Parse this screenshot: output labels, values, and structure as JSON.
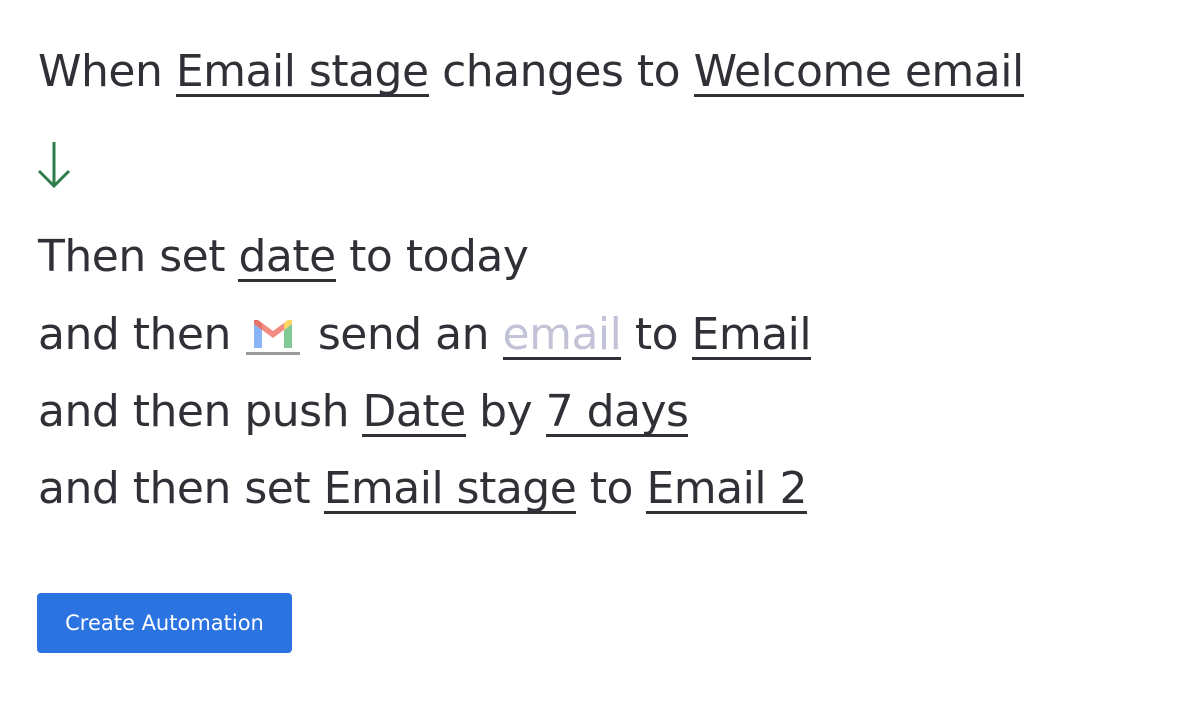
{
  "trigger": {
    "prefix": "When",
    "field": "Email stage",
    "verb": "changes to",
    "value": "Welcome email"
  },
  "arrow": {
    "icon": "arrow-down-icon",
    "color": "#2e7d4a"
  },
  "actions": [
    {
      "prefix": "Then set",
      "field": "date",
      "suffix": "to today"
    },
    {
      "prefix": "and then",
      "app_icon": "gmail-icon",
      "verb": "send an",
      "object": "email",
      "connector": "to",
      "target": "Email"
    },
    {
      "prefix": "and then push",
      "field": "Date",
      "connector": "by",
      "value": "7 days"
    },
    {
      "prefix": "and then set",
      "field": "Email stage",
      "connector": "to",
      "value": "Email 2"
    }
  ],
  "create_button": {
    "label": "Create Automation",
    "color": "#2a73e0"
  }
}
